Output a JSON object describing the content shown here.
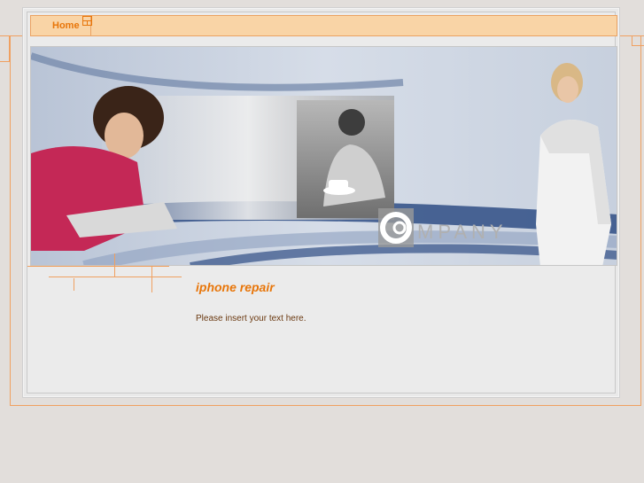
{
  "nav": {
    "home_label": "Home"
  },
  "banner": {
    "logo_text": "MPANY",
    "logo_letter": "CO"
  },
  "content": {
    "title": "iphone repair",
    "body": "Please insert your text here."
  },
  "colors": {
    "accent": "#e8760a",
    "nav_bg": "#f9d4a6",
    "frame": "#f0a060",
    "body_text": "#6b3a12"
  }
}
